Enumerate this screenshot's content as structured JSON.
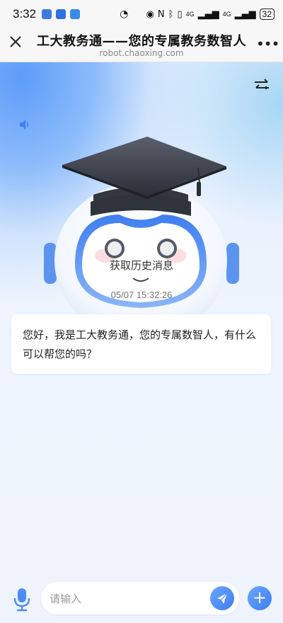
{
  "status_bar": {
    "time": "3:32",
    "signal_1": "4G",
    "signal_2": "4G",
    "battery": "32"
  },
  "titlebar": {
    "close_icon": "close-icon",
    "title": "工大教务通——您的专属教务数智人",
    "url": "robot.chaoxing.com",
    "more_icon": "more-icon"
  },
  "chat": {
    "history_link": "获取历史消息",
    "timestamp": "05/07 15:32:26",
    "greeting": "您好，我是工大教务通，您的专属数智人，有什么可以帮您的吗？"
  },
  "input": {
    "placeholder": "请输入"
  },
  "colors": {
    "accent": "#3f7ef0",
    "background": "#eef4fd"
  }
}
